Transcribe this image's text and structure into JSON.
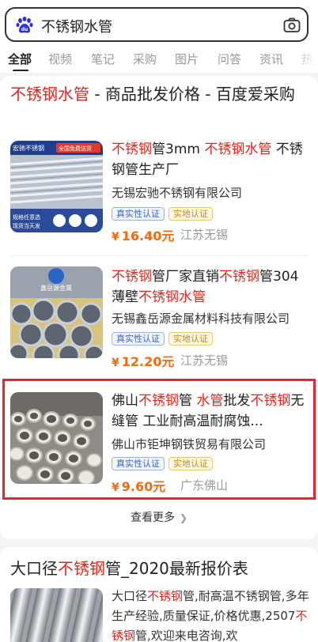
{
  "search": {
    "query": "不锈钢水管",
    "icons": {
      "logo": "baidu-paw-logo",
      "camera": "camera-icon"
    }
  },
  "tabs": [
    "全部",
    "视频",
    "笔记",
    "采购",
    "图片",
    "问答",
    "资讯",
    "热"
  ],
  "card1": {
    "title_red": "不锈钢水管",
    "title_rest": " - 商品批发价格 - 百度爱采购",
    "items": [
      {
        "title_parts": [
          {
            "t": "不锈钢",
            "red": true
          },
          {
            "t": "管3mm ",
            "red": false
          },
          {
            "t": "不锈钢水管",
            "red": true
          },
          {
            "t": " 不锈钢管生产厂",
            "red": false
          }
        ],
        "company": "无锡宏驰不锈钢有限公司",
        "badges": [
          "真实性认证",
          "实地认证"
        ],
        "currency": "¥",
        "price": "16.40元",
        "location": "江苏无锡",
        "thumb_text": {
          "header": "宏驰不锈钢",
          "header2": "全国免费送货",
          "side": "规格任意选\n现货当天发"
        }
      },
      {
        "title_parts": [
          {
            "t": "不锈钢",
            "red": true
          },
          {
            "t": "管厂家直销",
            "red": false
          },
          {
            "t": "不锈钢",
            "red": true
          },
          {
            "t": "管304薄壁",
            "red": false
          },
          {
            "t": "不锈钢水管",
            "red": true
          }
        ],
        "company": "无锡鑫岳源金属材料科技有限公司",
        "badges": [
          "真实性认证",
          "实地认证"
        ],
        "currency": "¥",
        "price": "12.20元",
        "location": "江苏无锡",
        "thumb_text": {
          "watermark": "鑫岳源金属"
        }
      },
      {
        "title_parts": [
          {
            "t": "佛山",
            "red": false
          },
          {
            "t": "不锈钢",
            "red": true
          },
          {
            "t": "管 ",
            "red": false
          },
          {
            "t": "水管",
            "red": true
          },
          {
            "t": "批发",
            "red": false
          },
          {
            "t": "不锈钢",
            "red": true
          },
          {
            "t": "无缝管 工业耐高温耐腐蚀...",
            "red": false
          }
        ],
        "company": "佛山市钜坤钢铁贸易有限公司",
        "badges": [
          "真实性认证",
          "实地认证"
        ],
        "currency": "¥",
        "price": "9.60元",
        "location": "广东佛山",
        "thumb_text": {}
      }
    ],
    "more_label": "查看更多",
    "more_icon": "chevron-right-icon"
  },
  "card2": {
    "title_parts": [
      {
        "t": "大口径",
        "red": false
      },
      {
        "t": "不锈钢",
        "red": true
      },
      {
        "t": "管_2020最新报价表",
        "red": false
      }
    ],
    "snippet_parts": [
      {
        "t": "大口径",
        "red": false
      },
      {
        "t": "不锈钢",
        "red": true
      },
      {
        "t": "管,耐高温不锈钢管,多年生产经验,质量保证,价格优惠,2507",
        "red": false
      },
      {
        "t": "不锈钢",
        "red": true
      },
      {
        "t": "管,欢迎来电咨询,欢",
        "red": false
      }
    ]
  },
  "colors": {
    "accent_red": "#e4251b",
    "price_orange": "#f36b0c",
    "badge_blue": "#3a62c8",
    "badge_gold": "#c48a13"
  }
}
